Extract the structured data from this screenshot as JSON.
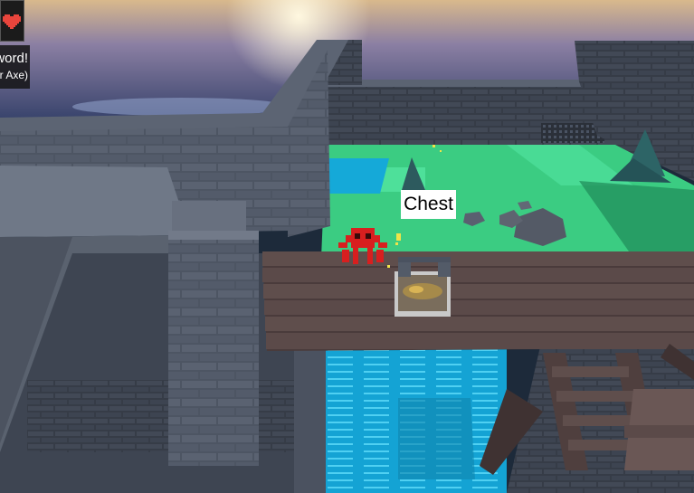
{
  "hud": {
    "heart_icon": "pixel-heart-icon",
    "notification_line1": "Sword!",
    "notification_line2": "(or Axe)"
  },
  "world_labels": {
    "chest": "Chest"
  },
  "colors": {
    "heart": "#e8453c",
    "enemy": "#d81f1f",
    "grass": "#3ccf84",
    "water": "#17a9d6",
    "planks": "#5e4c4b",
    "stone": "#4a5363"
  }
}
